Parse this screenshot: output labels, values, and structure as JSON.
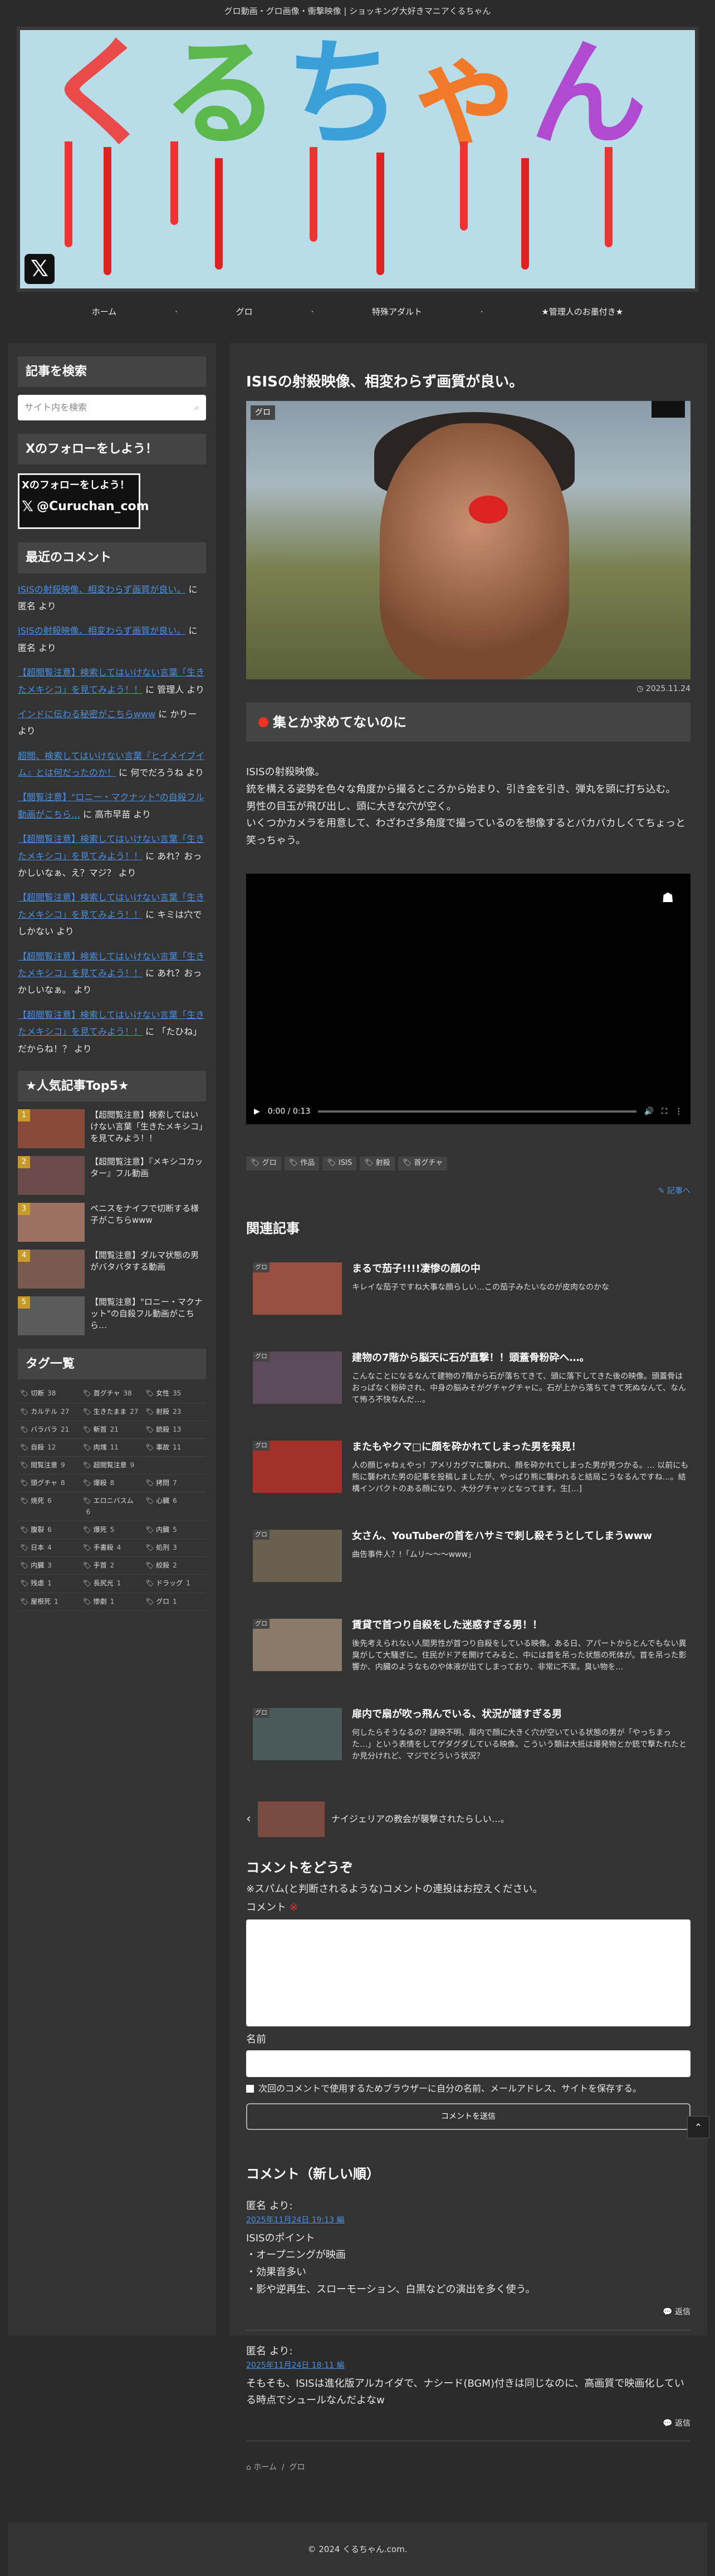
{
  "site": {
    "tagline": "グロ動画・グロ画像・衝撃映像 | ショッキング大好きマニアくるちゃん",
    "logo_text": "くるちゃん",
    "footer": "© 2024 くるちゃん.com."
  },
  "nav": [
    "ホーム",
    "グロ",
    "特殊アダルト",
    "★管理人のお墨付き★"
  ],
  "sidebar": {
    "search_title": "記事を検索",
    "search_placeholder": "サイト内を検索",
    "follow_title": "Xのフォローをしよう！",
    "follow_line1": "Xのフォローをしよう！",
    "follow_handle": "@Curuchan_com",
    "recent_title": "最近のコメント",
    "comments": [
      {
        "link": "ISISの射殺映像、相変わらず画質が良い。",
        "tail": " に 匿名 より"
      },
      {
        "link": "ISISの射殺映像、相変わらず画質が良い。",
        "tail": " に 匿名 より"
      },
      {
        "link": "【超閲覧注意】検索してはいけない言葉「生きたメキシコ」を見てみよう！！",
        "tail": " に 管理人 より"
      },
      {
        "link": "インドに伝わる秘密がこちらwww",
        "tail": " に かりー より"
      },
      {
        "link": "超閲、検索してはいけない言葉『ヒイメイブイム』とは何だったのか！",
        "tail": " に 何でだろうね より"
      },
      {
        "link": "【閲覧注意】\"ロニー・マクナット\"の自殺フル動画がこちら…",
        "tail": " に 高市早苗 より"
      },
      {
        "link": "【超閲覧注意】検索してはいけない言葉「生きたメキシコ」を見てみよう！！",
        "tail": " に あれ？おっかしいなぁ、え？マジ？ より"
      },
      {
        "link": "【超閲覧注意】検索してはいけない言葉「生きたメキシコ」を見てみよう！！",
        "tail": " に キミは穴でしかない より"
      },
      {
        "link": "【超閲覧注意】検索してはいけない言葉「生きたメキシコ」を見てみよう！！",
        "tail": " に あれ？おっかしいなぁ。 より"
      },
      {
        "link": "【超閲覧注意】検索してはいけない言葉「生きたメキシコ」を見てみよう！！",
        "tail": " に 「たひね」だからね！？ より"
      }
    ],
    "popular_title": "★人気記事Top5★",
    "popular": [
      "【超閲覧注意】検索してはいけない言葉「生きたメキシコ」を見てみよう！！",
      "【超閲覧注意】『メキシコカッター』フル動画",
      "ペニスをナイフで切断する様子がこちらwww",
      "【閲覧注意】ダルマ状態の男がバタバタする動画",
      "【閲覧注意】\"ロニー・マクナット\"の自殺フル動画がこちら…"
    ],
    "tag_title": "タグ一覧",
    "tags": [
      [
        "切断",
        "38"
      ],
      [
        "首グチャ",
        "38"
      ],
      [
        "女性",
        "35"
      ],
      [
        "カルテル",
        "27"
      ],
      [
        "生きたまま",
        "27"
      ],
      [
        "射殺",
        "23"
      ],
      [
        "バラバラ",
        "21"
      ],
      [
        "斬首",
        "21"
      ],
      [
        "銃殺",
        "13"
      ],
      [
        "自殺",
        "12"
      ],
      [
        "肉塊",
        "11"
      ],
      [
        "事故",
        "11"
      ],
      [
        "閲覧注意",
        "9"
      ],
      [
        "超閲覧注意",
        "9"
      ],
      [
        "",
        ""
      ],
      [
        "頭グチャ",
        "8"
      ],
      [
        "爆殺",
        "8"
      ],
      [
        "拷問",
        "7"
      ],
      [
        "焼死",
        "6"
      ],
      [
        "エロニバスム",
        "6"
      ],
      [
        "心臓",
        "6"
      ],
      [
        "腹裂",
        "6"
      ],
      [
        "爆死",
        "5"
      ],
      [
        "内臓",
        "5"
      ],
      [
        "日本",
        "4"
      ],
      [
        "手書殺",
        "4"
      ],
      [
        "処刑",
        "3"
      ],
      [
        "内臓",
        "3"
      ],
      [
        "手首",
        "2"
      ],
      [
        "絞殺",
        "2"
      ],
      [
        "残虐",
        "1"
      ],
      [
        "長尻光",
        "1"
      ],
      [
        "ドラッグ",
        "1"
      ],
      [
        "屋根死",
        "1"
      ],
      [
        "惨劇",
        "1"
      ],
      [
        "グロ",
        "1"
      ]
    ]
  },
  "post": {
    "title": "ISISの射殺映像、相変わらず画質が良い。",
    "category": "グロ",
    "date": "2025.11.24",
    "h2": "集とか求めてないのに",
    "body": [
      "ISISの射殺映像。",
      "銃を構える姿勢を色々な角度から撮るところから始まり、引き金を引き、弾丸を頭に打ち込む。",
      "男性の目玉が飛び出し、頭に大きな穴が空く。",
      "いくつかカメラを用意して、わざわざ多角度で撮っているのを想像するとバカバカしくてちょっと笑っちゃう。"
    ],
    "video_time": "0:00 / 0:13",
    "video_progress": 0.0,
    "tags": [
      "グロ",
      "作品",
      "ISIS",
      "射殺",
      "首グチャ"
    ],
    "share": "記事へ",
    "related_title": "関連記事",
    "related": [
      {
        "cat": "グロ",
        "title": "まるで茄子!!!!凄惨の顔の中",
        "excerpt": "キレイな茄子ですね大事な顔らしい…この茄子みたいなのが皮肉なのかな"
      },
      {
        "cat": "グロ",
        "title": "建物の7階から脳天に石が直撃！！頭蓋骨粉砕へ…。",
        "excerpt": "こんなことになるなんて建物の7階から石が落ちてきて、頭に落下してきた後の映像。頭蓋骨はおっぱなく粉砕され、中身の脳みそがグチャグチャに。石が上から落ちてきて死ぬなんて、なんて怖ろ不快なんだ…。"
      },
      {
        "cat": "グロ",
        "title": "またもやクマ□に顔を砕かれてしまった男を発見！",
        "excerpt": "人の顔じゃねぇやっ！アメリカグマに襲われ、顔を砕かれてしまった男が見つかる。… 以前にも熊に襲われた男の記事を投稿しましたが、やっぱり熊に襲われると結局こうなるんですね…。結構インパクトのある顔になり、大分グチャッとなってます。生[…]"
      },
      {
        "cat": "グロ",
        "title": "女さん、YouTuberの首をハサミで刺し殺そうとしてしまうwww",
        "excerpt": "曲告事件人？!「ムリ〜〜〜www」"
      },
      {
        "cat": "グロ",
        "title": "賃貸で首つり自殺をした迷惑すぎる男！！",
        "excerpt": "後先考えられない人間男性が首つり自殺をしている映像。ある日、アパートからとんでもない異臭がして大騒ぎに。住民がドアを開けてみると、中には首を吊った状態の死体が。首を吊った影響か、内臓のようなものや体液が出てしまっており、非常に不潔。臭い物を…"
      },
      {
        "cat": "グロ",
        "title": "扉内で扇が吹っ飛んでいる、状況が謎すぎる男",
        "excerpt": "何したらそうなるの？謎映不明、扉内で顔に大きく穴が空いている状態の男が「やっちまった…」という表情をしてゲダグダしている映像。こういう類は大抵は爆発物とか銃で撃たれたとか見分けれど、マジでどういう状況？"
      }
    ],
    "prev_title": "ナイジェリアの教会が襲撃されたらしい…。"
  },
  "form": {
    "title": "コメントをどうぞ",
    "note": "※スパム(と判断されるような)コメントの連投はお控えください。",
    "comment_label": "コメント",
    "required_mark": "※",
    "name_label": "名前",
    "remember": "次回のコメントで使用するためブラウザーに自分の名前、メールアドレス、サイトを保存する。",
    "submit": "コメントを送信"
  },
  "comments_section": {
    "title": "コメント（新しい順）",
    "items": [
      {
        "who": "匿名 より:",
        "when": "2025年11月24日 19:13 編",
        "lines": [
          "ISISのポイント",
          "・オープニングが映画",
          "・効果音多い",
          "・影や逆再生、スローモーション、白黒などの演出を多く使う。"
        ],
        "reply": "返信"
      },
      {
        "who": "匿名 より:",
        "when": "2025年11月24日 18:11 編",
        "lines": [
          "そもそも、ISISは進化版アルカイダで、ナシード(BGM)付きは同じなのに、高画質で映画化している時点でシュールなんだよなw"
        ],
        "reply": "返信"
      }
    ]
  },
  "breadcrumb": [
    "ホーム",
    "グロ"
  ],
  "colors": {
    "accent": "#4a90e2",
    "bg": "#2b2b2b",
    "panel": "#333333",
    "required": "#ee3333"
  }
}
